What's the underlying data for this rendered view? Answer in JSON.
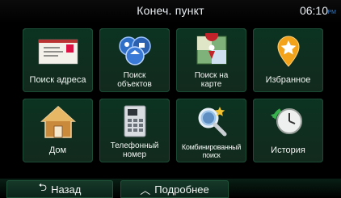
{
  "header": {
    "title": "Конеч. пункт",
    "time": "06:10",
    "time_suffix": "PM"
  },
  "tiles": [
    {
      "label": "Поиск адреса",
      "icon": "address-card-icon"
    },
    {
      "label_line1": "Поиск",
      "label_line2": "объектов",
      "icon": "poi-search-icon"
    },
    {
      "label_line1": "Поиск на",
      "label_line2": "карте",
      "icon": "map-search-icon"
    },
    {
      "label": "Избранное",
      "icon": "favorite-star-icon"
    },
    {
      "label": "Дом",
      "icon": "home-icon"
    },
    {
      "label_line1": "Телефонный",
      "label_line2": "номер",
      "icon": "phone-icon"
    },
    {
      "label_line1": "Комбинированный",
      "label_line2": "поиск",
      "icon": "combined-search-icon"
    },
    {
      "label": "История",
      "icon": "history-clock-icon"
    }
  ],
  "footer": {
    "back_label": "Назад",
    "more_label": "Подробнее"
  },
  "colors": {
    "tile_bg": "#0f2f20",
    "accent_blue": "#2e7bd0"
  }
}
